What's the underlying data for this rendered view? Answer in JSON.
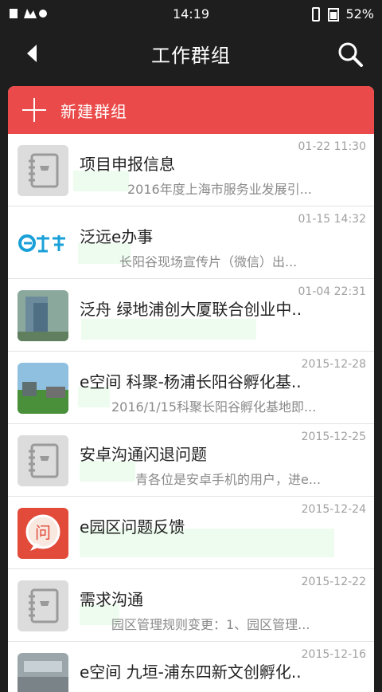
{
  "status_bar": {
    "time": "14:19",
    "battery": "52%"
  },
  "header": {
    "title": "工作群组"
  },
  "new_group_label": "新建群组",
  "groups": [
    {
      "name": "项目申报信息",
      "time": "01-22 11:30",
      "preview": "2016年度上海市服务业发展引..."
    },
    {
      "name": "泛远e办事",
      "time": "01-15 14:32",
      "preview": "长阳谷现场宣传片（微信）出..."
    },
    {
      "name": "泛舟 绿地浦创大厦联合创业中..",
      "time": "01-04 22:31",
      "preview": ""
    },
    {
      "name": "e空间 科聚-杨浦长阳谷孵化基..",
      "time": "2015-12-28",
      "preview": "2016/1/15科聚长阳谷孵化基地即..."
    },
    {
      "name": "安卓沟通闪退问题",
      "time": "2015-12-25",
      "preview": "青各位是安卓手机的用户，进e..."
    },
    {
      "name": "e园区问题反馈",
      "time": "2015-12-24",
      "preview": ""
    },
    {
      "name": "需求沟通",
      "time": "2015-12-22",
      "preview": "园区管理规则变更：1、园区管理..."
    },
    {
      "name": "e空间 九垣-浦东四新文创孵化..",
      "time": "2015-12-16",
      "preview": ""
    }
  ],
  "logo_text": "e办事"
}
